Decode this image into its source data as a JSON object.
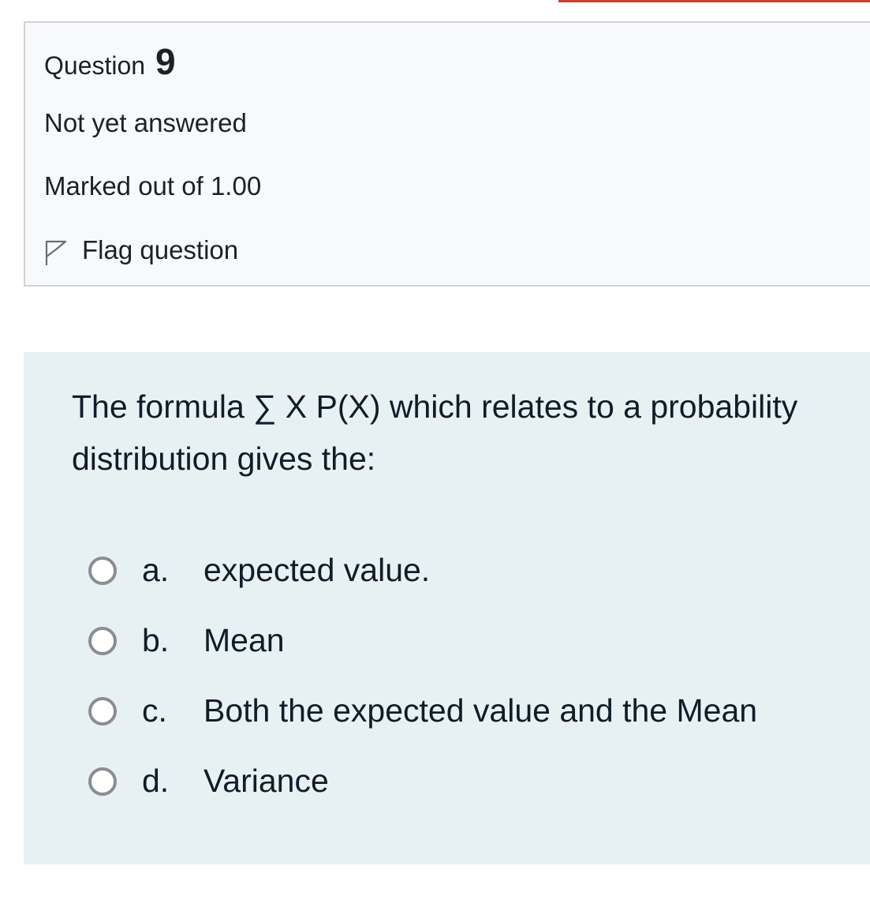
{
  "info": {
    "question_label": "Question",
    "question_number": "9",
    "state": "Not yet answered",
    "grade": "Marked out of 1.00",
    "flag_label": "Flag question",
    "flag_icon": "flag-outline-icon"
  },
  "question": {
    "text": "The formula ∑ X P(X) which relates to a probability distribution gives the:",
    "answers": [
      {
        "letter": "a.",
        "text": "expected value."
      },
      {
        "letter": "b.",
        "text": "Mean"
      },
      {
        "letter": "c.",
        "text": "Both the expected value and the Mean"
      },
      {
        "letter": "d.",
        "text": "Variance"
      }
    ]
  },
  "colors": {
    "accent": "#c8412b",
    "info_background": "#f8f9fa",
    "question_background": "#e7f1f4",
    "radio_border": "#8a8d91"
  }
}
